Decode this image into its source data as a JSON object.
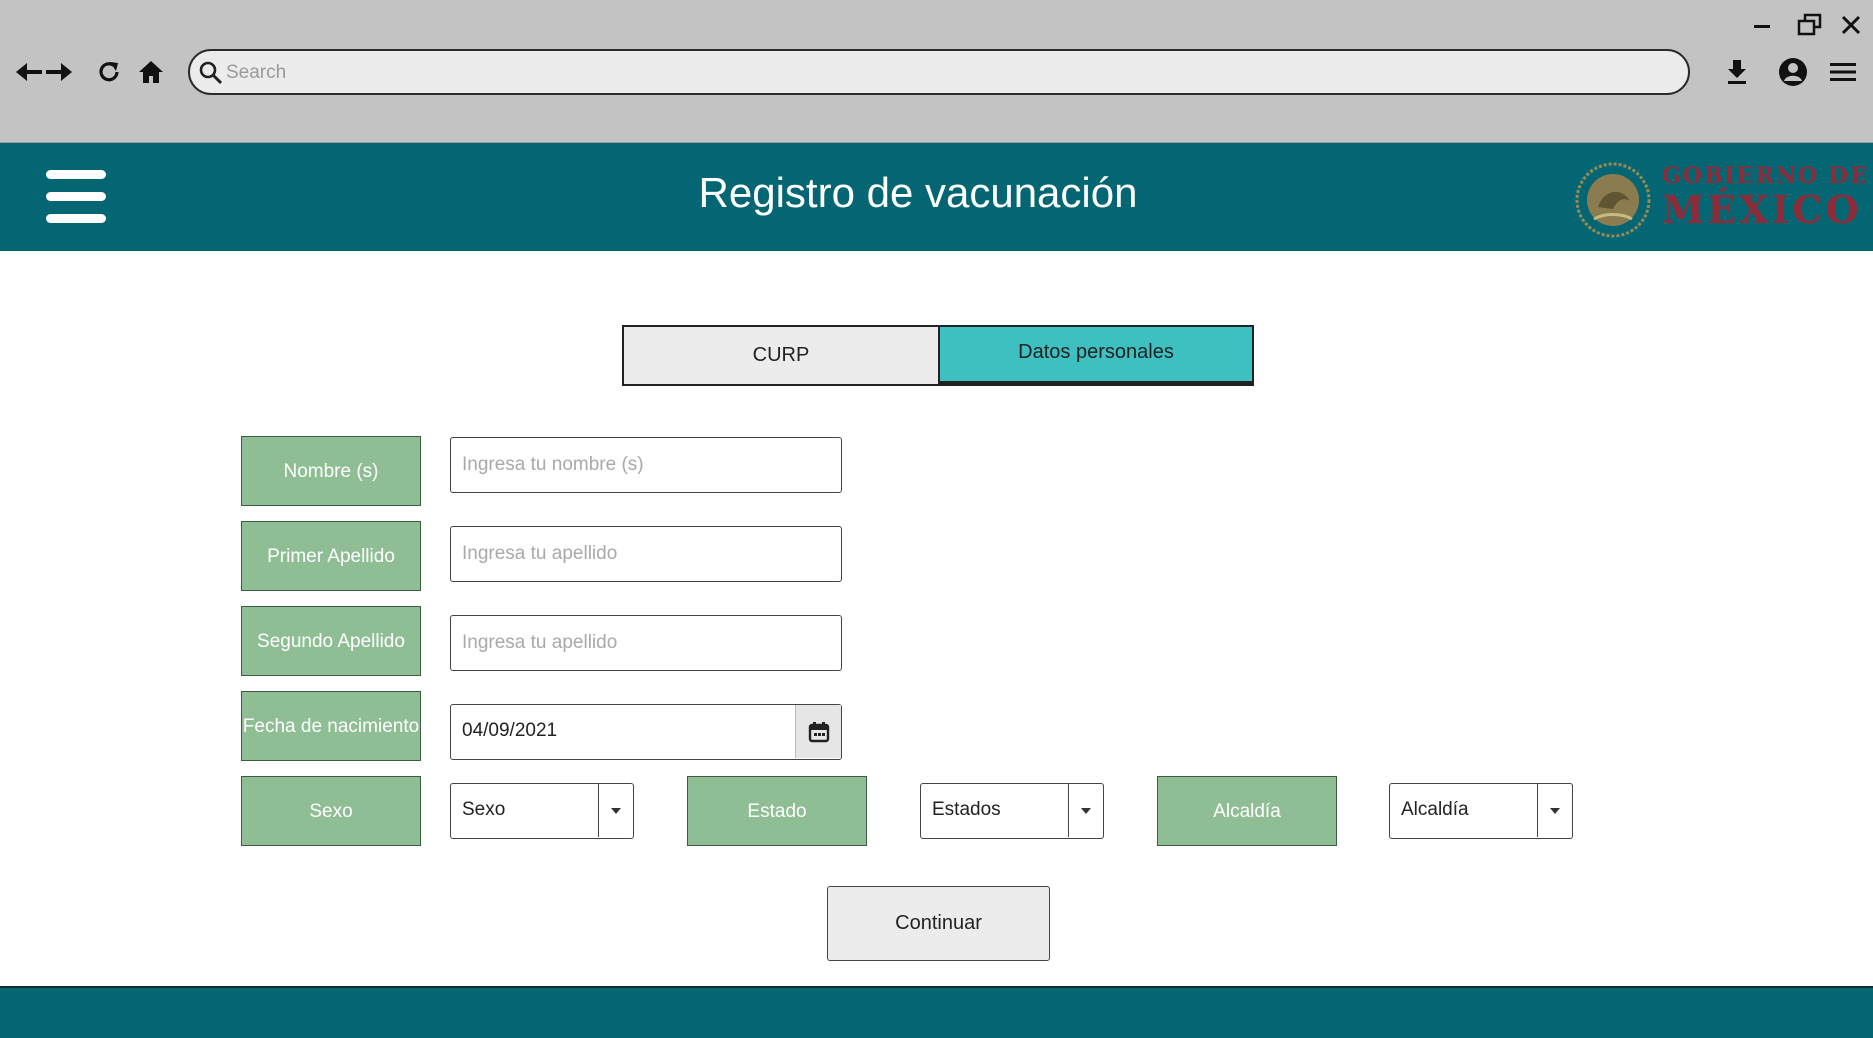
{
  "browser": {
    "search_placeholder": "Search",
    "icons": [
      "back-icon",
      "forward-icon",
      "reload-icon",
      "home-icon",
      "download-icon",
      "account-icon",
      "menu-icon",
      "minimize-icon",
      "restore-icon",
      "close-icon"
    ]
  },
  "header": {
    "title": "Registro de vacunación",
    "gov_line1": "GOBIERNO DE",
    "gov_line2": "MÉXICO",
    "background": "#046672",
    "brand_color": "#8f2c3a"
  },
  "tabs": [
    {
      "label": "CURP",
      "active": false
    },
    {
      "label": "Datos personales",
      "active": true
    }
  ],
  "form": {
    "nombre": {
      "label": "Nombre (s)",
      "placeholder": "Ingresa tu nombre (s)"
    },
    "primer_apellido": {
      "label": "Primer Apellido",
      "placeholder": "Ingresa tu apellido"
    },
    "segundo_apellido": {
      "label": "Segundo Apellido",
      "placeholder": "Ingresa tu apellido"
    },
    "fecha": {
      "label": "Fecha de nacimiento",
      "value": "04/09/2021"
    },
    "sexo": {
      "label": "Sexo",
      "value": "Sexo"
    },
    "estado": {
      "label": "Estado",
      "value": "Estados"
    },
    "alcaldia": {
      "label": "Alcaldía",
      "value": "Alcaldía"
    },
    "label_color": "#8fbe95"
  },
  "actions": {
    "continue_label": "Continuar"
  }
}
